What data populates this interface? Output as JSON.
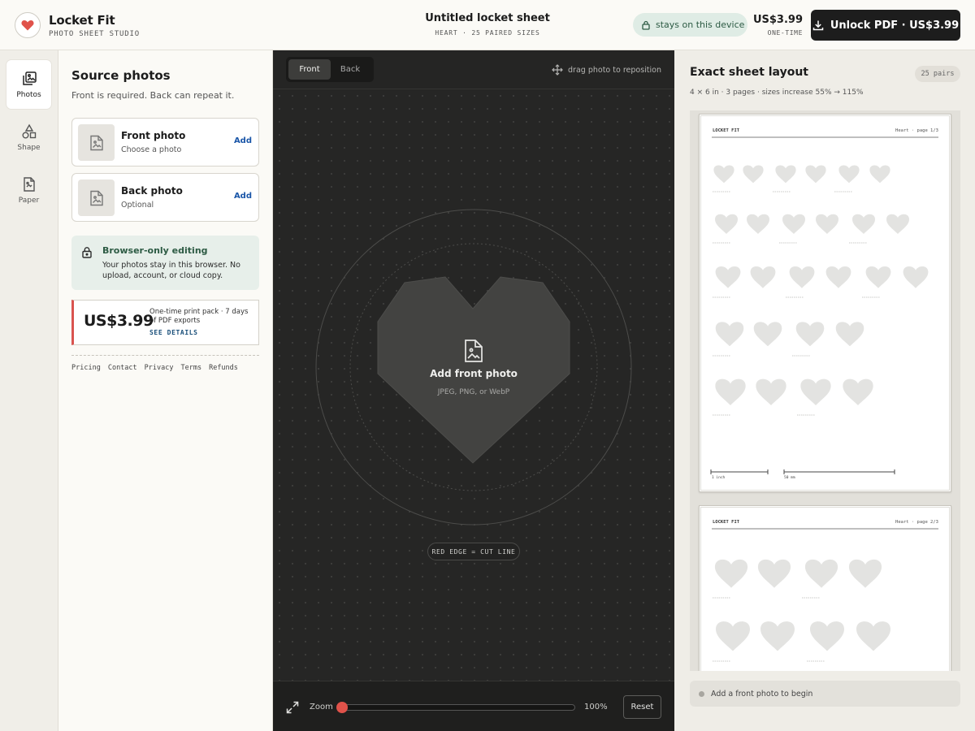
{
  "app": {
    "name": "Locket Fit",
    "tagline": "PHOTO SHEET STUDIO"
  },
  "document": {
    "title": "Untitled locket sheet",
    "subtitle": "HEART · 25 PAIRED SIZES"
  },
  "header": {
    "device_pill": "stays on this device",
    "price": "US$3.99",
    "price_note": "ONE-TIME",
    "unlock_label": "Unlock PDF · US$3.99"
  },
  "rail": [
    {
      "label": "Photos",
      "icon": "photos-icon",
      "active": true
    },
    {
      "label": "Shape",
      "icon": "shape-icon",
      "active": false
    },
    {
      "label": "Paper",
      "icon": "paper-icon",
      "active": false
    }
  ],
  "source": {
    "title": "Source photos",
    "subtitle": "Front is required. Back can repeat it.",
    "photos": [
      {
        "name": "Front photo",
        "hint": "Choose a photo",
        "action": "Add"
      },
      {
        "name": "Back photo",
        "hint": "Optional",
        "action": "Add"
      }
    ],
    "privacy": {
      "title": "Browser-only editing",
      "body": "Your photos stay in this browser. No upload, account, or cloud copy."
    },
    "pack": {
      "price": "US$3.99",
      "description": "One-time print pack · 7 days of PDF exports",
      "link": "SEE DETAILS"
    },
    "footer_links": [
      "Pricing",
      "Contact",
      "Privacy",
      "Terms",
      "Refunds"
    ]
  },
  "canvas": {
    "tabs": [
      {
        "label": "Front",
        "active": true
      },
      {
        "label": "Back",
        "active": false
      }
    ],
    "drag_hint": "drag photo to reposition",
    "placeholder_title": "Add front photo",
    "placeholder_hint": "JPEG, PNG, or WebP",
    "cut_line_label": "RED EDGE = CUT LINE",
    "zoom_label": "Zoom",
    "zoom_value": "100%",
    "zoom_fraction": 0,
    "reset_label": "Reset"
  },
  "layout": {
    "title": "Exact sheet layout",
    "badge": "25 pairs",
    "subtitle": "4 × 6 in · 3 pages · sizes increase 55% → 115%",
    "status": "Add a front photo to begin",
    "sheets": [
      {
        "brand": "LOCKET FIT",
        "page": "Heart · page 1/3"
      },
      {
        "brand": "LOCKET FIT",
        "page": "Heart · page 2/3"
      }
    ],
    "scale_labels": [
      "1 inch",
      "50 mm"
    ]
  },
  "colors": {
    "accent_red": "#e0524a",
    "privacy_green": "#2d5b44",
    "link_blue": "#1a56a8",
    "canvas_bg": "#262625"
  }
}
